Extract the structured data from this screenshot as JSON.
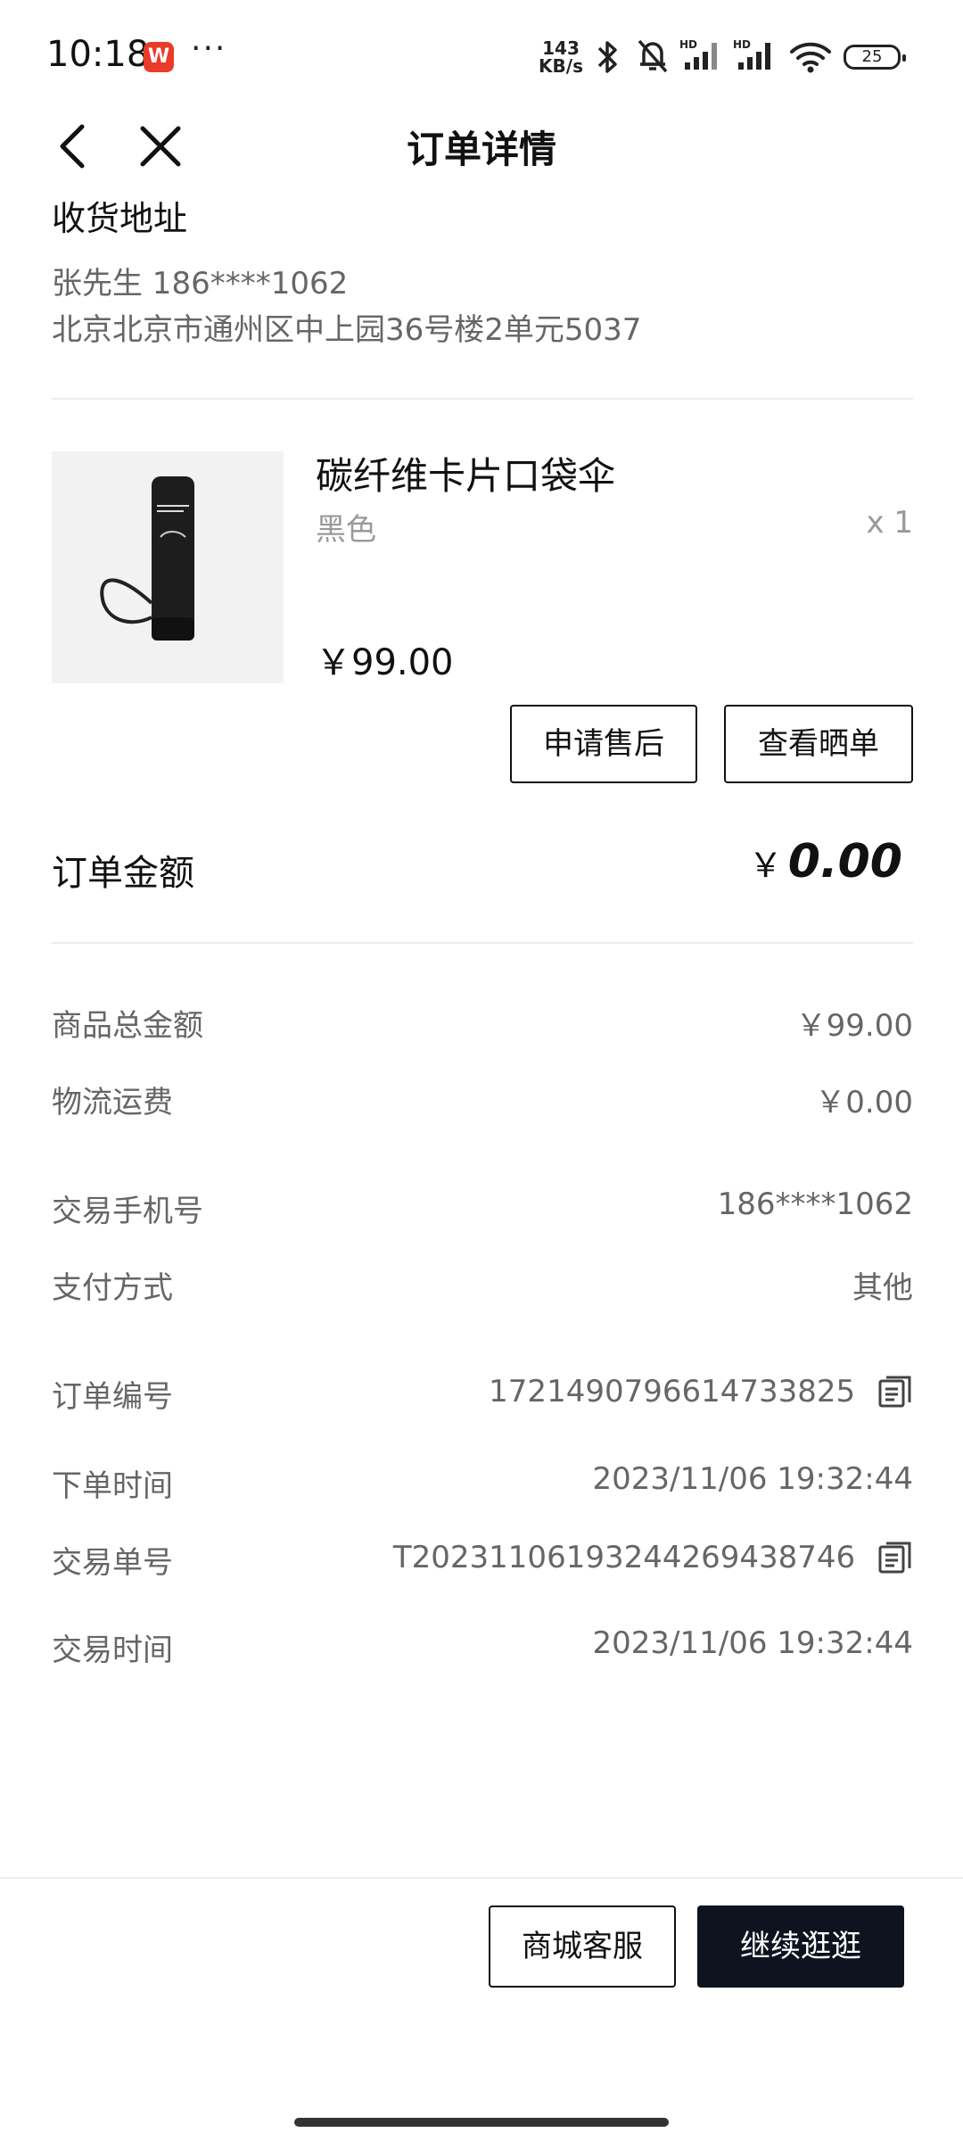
{
  "status_bar": {
    "time": "10:18",
    "app_badge": "W",
    "more": "···",
    "net_speed_value": "143",
    "net_speed_unit": "KB/s",
    "battery": "25"
  },
  "header": {
    "title": "订单详情"
  },
  "address": {
    "heading": "收货地址",
    "contact": "张先生  186****1062",
    "detail": "北京北京市通州区中上园36号楼2单元5037"
  },
  "product": {
    "name": "碳纤维卡片口袋伞",
    "variant": "黑色",
    "quantity": "x 1",
    "price": "￥99.00",
    "after_sale_button": "申请售后",
    "view_review_button": "查看晒单"
  },
  "order_total": {
    "label": "订单金额",
    "currency": "￥",
    "amount": "0.00"
  },
  "details": {
    "goods_total_label": "商品总金额",
    "goods_total_value": "￥99.00",
    "shipping_label": "物流运费",
    "shipping_value": "￥0.00",
    "phone_label": "交易手机号",
    "phone_value": "186****1062",
    "payment_label": "支付方式",
    "payment_value": "其他",
    "order_no_label": "订单编号",
    "order_no_value": "1721490796614733825",
    "order_time_label": "下单时间",
    "order_time_value": "2023/11/06 19:32:44",
    "trade_no_label": "交易单号",
    "trade_no_value": "T20231106193244269438746",
    "trade_time_label": "交易时间",
    "trade_time_value": "2023/11/06 19:32:44"
  },
  "footer": {
    "service_button": "商城客服",
    "continue_button": "继续逛逛"
  }
}
